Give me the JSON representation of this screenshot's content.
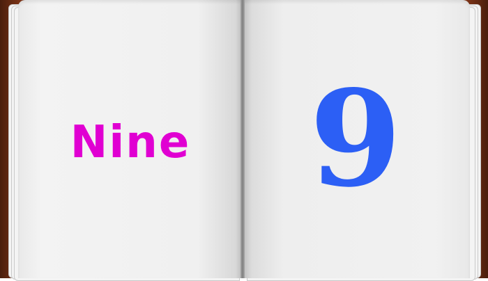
{
  "book": {
    "left_page": {
      "word": "Nine",
      "color": "#e000d2"
    },
    "right_page": {
      "numeral": "9",
      "color": "#2c5ff5"
    },
    "cover_color": "#8a3d1c"
  }
}
